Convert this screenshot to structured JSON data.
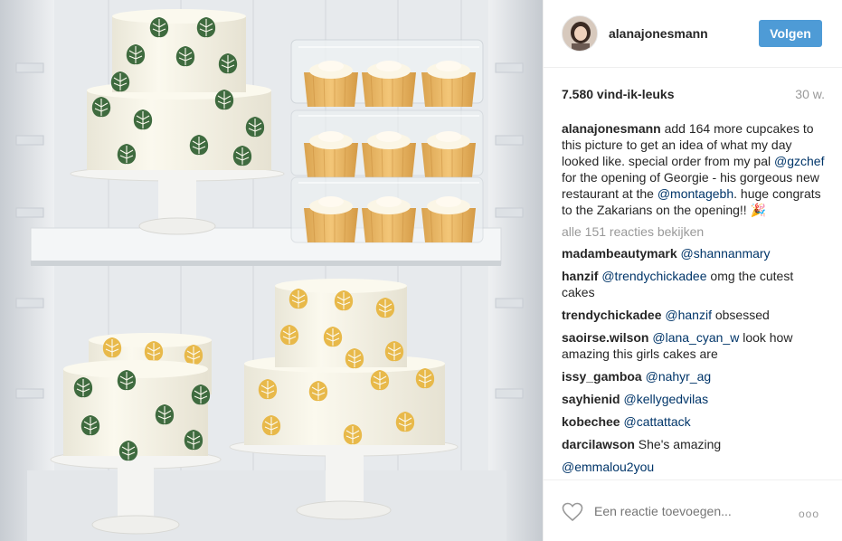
{
  "post": {
    "username": "alanajonesmann",
    "follow_label": "Volgen",
    "likes": "7.580 vind-ik-leuks",
    "time": "30 w.",
    "caption": {
      "user": "alanajonesmann",
      "text1": " add 164 more cupcakes to this picture to get an idea of what my day looked like. special order from my pal ",
      "mention1": "@gzchef",
      "text2": " for the opening of Georgie - his gorgeous new restaurant at the ",
      "mention2": "@montagebh",
      "text3": ". huge congrats to the Zakarians on the opening!! 🎉"
    },
    "view_all": "alle 151 reacties bekijken",
    "comments": [
      {
        "user": "madambeautymark",
        "mention": "@shannanmary",
        "text": ""
      },
      {
        "user": "hanzif",
        "mention": "@trendychickadee",
        "text": " omg the cutest cakes"
      },
      {
        "user": "trendychickadee",
        "mention": "@hanzif",
        "text": " obsessed"
      },
      {
        "user": "saoirse.wilson",
        "mention": "@lana_cyan_w",
        "text": " look how amazing this girls cakes are"
      },
      {
        "user": "issy_gamboa",
        "mention": "@nahyr_ag",
        "text": ""
      },
      {
        "user": "sayhienid",
        "mention": "@kellygedvilas",
        "text": ""
      },
      {
        "user": "kobechee",
        "mention": "@cattattack",
        "text": ""
      },
      {
        "user": "darcilawson",
        "mention": "",
        "text": " She's amazing"
      },
      {
        "user": "",
        "mention": "@emmalou2you",
        "text": ""
      }
    ],
    "comment_placeholder": "Een reactie toevoegen...",
    "more_label": "ooo"
  },
  "icons": {
    "heart": "heart-icon",
    "more": "more-options-icon"
  },
  "colors": {
    "follow_button": "#4e9bd6",
    "mention": "#003569",
    "muted": "#999999",
    "green_leaf": "#3f6b3f",
    "yellow_leaf": "#e8b94a"
  }
}
